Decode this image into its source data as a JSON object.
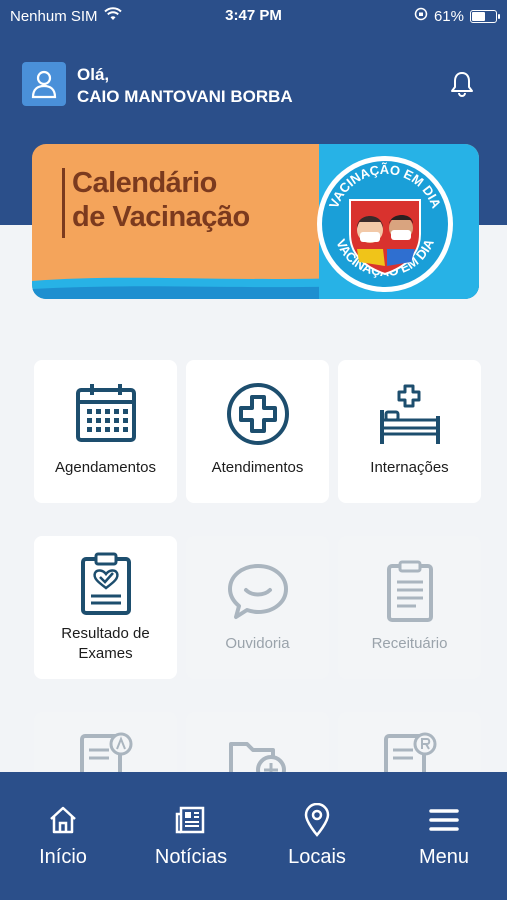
{
  "status_bar": {
    "carrier": "Nenhum SIM",
    "time": "3:47 PM",
    "battery": "61%",
    "battery_level": 0.61
  },
  "header": {
    "greeting": "Olá,",
    "user_name": "CAIO MANTOVANI BORBA"
  },
  "banner": {
    "title_line1": "Calendário",
    "title_line2": "de Vacinação",
    "badge_top": "VACINAÇÃO EM DIA",
    "badge_bottom": "VACINAÇÃO EM DIA"
  },
  "menu": {
    "agendamentos": "Agendamentos",
    "atendimentos": "Atendimentos",
    "internacoes": "Internações",
    "resultado_line1": "Resultado de",
    "resultado_line2": "Exames",
    "ouvidoria": "Ouvidoria",
    "receituario": "Receituário"
  },
  "bottom_nav": {
    "inicio": "Início",
    "noticias": "Notícias",
    "locais": "Locais",
    "menu": "Menu"
  },
  "colors": {
    "primary": "#2b4f8a",
    "icon": "#1d4e6e",
    "banner_orange": "#f4a45b",
    "banner_blue": "#27b2e6"
  }
}
